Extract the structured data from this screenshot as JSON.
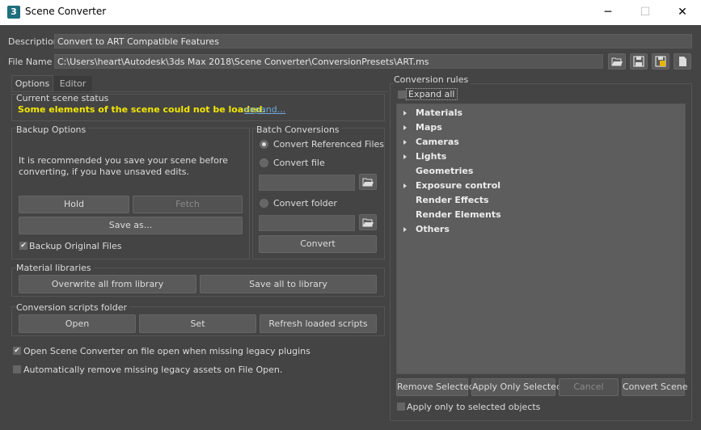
{
  "window": {
    "title": "Scene Converter",
    "minimize_glyph": "─",
    "maximize_glyph": "☐",
    "close_glyph": "✕",
    "app_icon_text": "3"
  },
  "description": {
    "label": "Description",
    "value": "Convert to ART Compatible Features"
  },
  "filename": {
    "label": "File Name",
    "value": "C:\\Users\\heart\\Autodesk\\3ds Max 2018\\Scene Converter\\ConversionPresets\\ART.ms"
  },
  "toolbar_icons": [
    "open-folder-icon",
    "save-icon",
    "save-as-icon",
    "new-file-icon"
  ],
  "tabs": [
    {
      "label": "Options"
    },
    {
      "label": "Editor"
    }
  ],
  "scene_status": {
    "title": "Current scene status",
    "message": "Some elements of the scene could not be loaded.",
    "expand_link": "expand..."
  },
  "backup": {
    "title": "Backup Options",
    "info_line1": "It is recommended you save your scene before",
    "info_line2": "converting, if you have unsaved edits.",
    "hold": "Hold",
    "fetch": "Fetch",
    "save_as": "Save as...",
    "backup_original": "Backup Original Files",
    "backup_checked": true
  },
  "batch": {
    "title": "Batch Conversions",
    "opt_referenced": "Convert Referenced Files",
    "opt_file": "Convert file",
    "opt_folder": "Convert folder",
    "convert": "Convert"
  },
  "material_libraries": {
    "title": "Material libraries",
    "overwrite": "Overwrite all from library",
    "save_all": "Save all to library"
  },
  "scripts": {
    "title": "Conversion scripts folder",
    "open": "Open",
    "set": "Set",
    "refresh": "Refresh loaded scripts"
  },
  "options": {
    "open_on_missing": "Open Scene Converter on file open when missing legacy plugins",
    "open_on_missing_checked": true,
    "auto_remove": "Automatically remove missing legacy assets on File Open.",
    "auto_remove_checked": false
  },
  "rules": {
    "title": "Conversion rules",
    "expand_all": "Expand all",
    "items": [
      {
        "label": "Materials",
        "expandable": true
      },
      {
        "label": "Maps",
        "expandable": true
      },
      {
        "label": "Cameras",
        "expandable": true
      },
      {
        "label": "Lights",
        "expandable": true
      },
      {
        "label": "Geometries",
        "expandable": false
      },
      {
        "label": "Exposure control",
        "expandable": true
      },
      {
        "label": "Render Effects",
        "expandable": false
      },
      {
        "label": "Render Elements",
        "expandable": false
      },
      {
        "label": "Others",
        "expandable": true
      }
    ],
    "remove_selected": "Remove Selected",
    "apply_only_selected": "Apply Only Selected",
    "cancel": "Cancel",
    "convert_scene": "Convert Scene",
    "apply_selected_objects": "Apply only to selected objects"
  },
  "colors": {
    "status_warning": "#f2e600",
    "link": "#6fa8dc",
    "background": "#444444"
  }
}
